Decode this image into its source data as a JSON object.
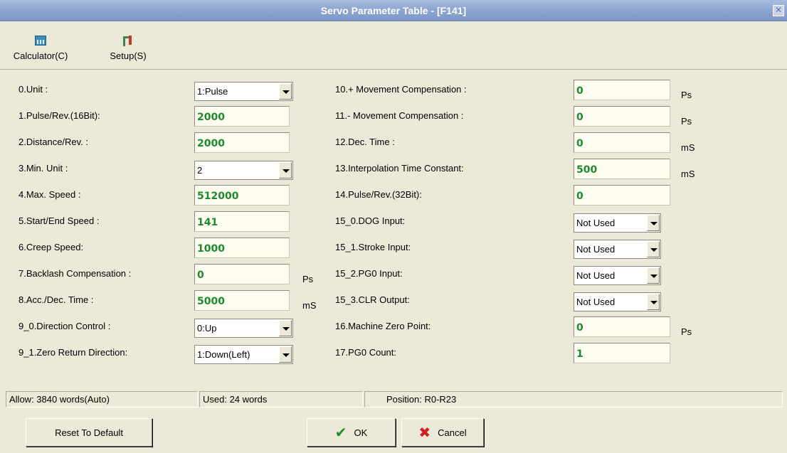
{
  "window": {
    "title": "Servo Parameter Table - [F141]"
  },
  "toolbar": {
    "calculator_label": "Calculator(C)",
    "setup_label": "Setup(S)"
  },
  "left_params": [
    {
      "label": "0.Unit :",
      "type": "select",
      "value": "1:Pulse",
      "unit": ""
    },
    {
      "label": "1.Pulse/Rev.(16Bit):",
      "type": "input",
      "value": "2000",
      "unit": ""
    },
    {
      "label": "2.Distance/Rev. :",
      "type": "input",
      "value": "2000",
      "unit": ""
    },
    {
      "label": "3.Min. Unit :",
      "type": "select",
      "value": "2",
      "unit": ""
    },
    {
      "label": "4.Max. Speed :",
      "type": "input",
      "value": "512000",
      "unit": ""
    },
    {
      "label": "5.Start/End Speed :",
      "type": "input",
      "value": "141",
      "unit": ""
    },
    {
      "label": "6.Creep Speed:",
      "type": "input",
      "value": "1000",
      "unit": ""
    },
    {
      "label": "7.Backlash Compensation :",
      "type": "input",
      "value": "0",
      "unit": "Ps"
    },
    {
      "label": "8.Acc./Dec. Time :",
      "type": "input",
      "value": "5000",
      "unit": "mS"
    },
    {
      "label": "9_0.Direction Control :",
      "type": "select",
      "value": "0:Up",
      "unit": ""
    },
    {
      "label": "9_1.Zero Return Direction:",
      "type": "select",
      "value": "1:Down(Left)",
      "unit": ""
    }
  ],
  "right_params": [
    {
      "label": "10.+ Movement Compensation :",
      "type": "input",
      "value": "0",
      "unit": "Ps"
    },
    {
      "label": "11.- Movement Compensation :",
      "type": "input",
      "value": "0",
      "unit": "Ps"
    },
    {
      "label": "12.Dec. Time :",
      "type": "input",
      "value": "0",
      "unit": "mS"
    },
    {
      "label": "13.Interpolation Time Constant:",
      "type": "input",
      "value": "500",
      "unit": "mS"
    },
    {
      "label": "14.Pulse/Rev.(32Bit):",
      "type": "input",
      "value": "0",
      "unit": ""
    },
    {
      "label": "15_0.DOG Input:",
      "type": "select",
      "value": "Not Used",
      "unit": ""
    },
    {
      "label": "15_1.Stroke Input:",
      "type": "select",
      "value": "Not Used",
      "unit": ""
    },
    {
      "label": "15_2.PG0 Input:",
      "type": "select",
      "value": "Not Used",
      "unit": ""
    },
    {
      "label": "15_3.CLR Output:",
      "type": "select",
      "value": "Not Used",
      "unit": ""
    },
    {
      "label": "16.Machine Zero Point:",
      "type": "input",
      "value": "0",
      "unit": "Ps"
    },
    {
      "label": "17.PG0 Count:",
      "type": "input",
      "value": "1",
      "unit": ""
    }
  ],
  "status": {
    "allow": "Allow: 3840 words(Auto)",
    "used": "Used: 24 words",
    "position": "Position: R0-R23"
  },
  "buttons": {
    "reset": "Reset To Default",
    "ok": "OK",
    "cancel": "Cancel"
  },
  "colors": {
    "title_bar": "#8fa6d2",
    "value_text": "#1e8a2e",
    "input_bg": "#fffdf0",
    "dialog_bg": "#ece9d8"
  }
}
